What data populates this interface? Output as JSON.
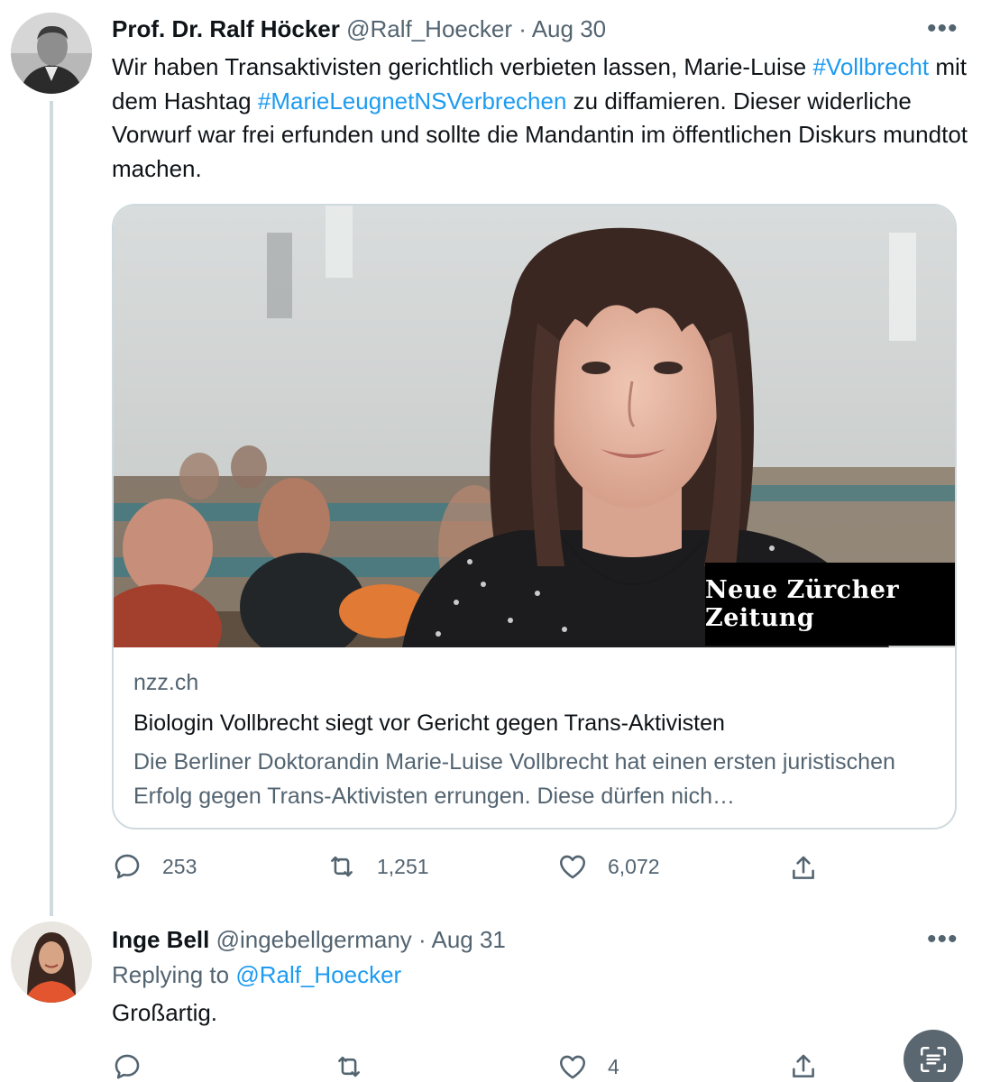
{
  "tweet1": {
    "author_name": "Prof. Dr. Ralf Höcker",
    "handle": "@Ralf_Hoecker",
    "separator": "·",
    "date": "Aug 30",
    "text_before_tag1": "Wir haben Transaktivisten gerichtlich verbieten lassen, Marie-Luise ",
    "hashtag1": "#Vollbrecht",
    "text_between_tags": " mit dem Hashtag ",
    "hashtag2": "#MarieLeugnetNSVerbrechen",
    "text_after_tag2": " zu diffamieren. Dieser widerliche Vorwurf war frei erfunden und sollte die Mandantin im öffentlichen Diskurs mundtot machen.",
    "card": {
      "logo_text": "Neue Zürcher Zeitung",
      "domain": "nzz.ch",
      "title": "Biologin Vollbrecht siegt vor Gericht gegen Trans-Aktivisten",
      "description": "Die Berliner Doktorandin Marie-Luise Vollbrecht hat einen ersten juristischen Erfolg gegen Trans-Aktivisten errungen. Diese dürfen nich…"
    },
    "actions": {
      "replies": "253",
      "retweets": "1,251",
      "likes": "6,072"
    },
    "more_icon": "more-icon"
  },
  "tweet2": {
    "author_name": "Inge Bell",
    "handle": "@ingebellgermany",
    "separator": "·",
    "date": "Aug 31",
    "replying_prefix": "Replying to ",
    "replying_mention": "@Ralf_Hoecker",
    "text": "Großartig.",
    "actions": {
      "replies": "",
      "retweets": "",
      "likes": "4"
    }
  },
  "colors": {
    "link": "#1d9bf0",
    "secondary_text": "#536471",
    "primary_text": "#0f1419",
    "border": "#cfd9de"
  }
}
